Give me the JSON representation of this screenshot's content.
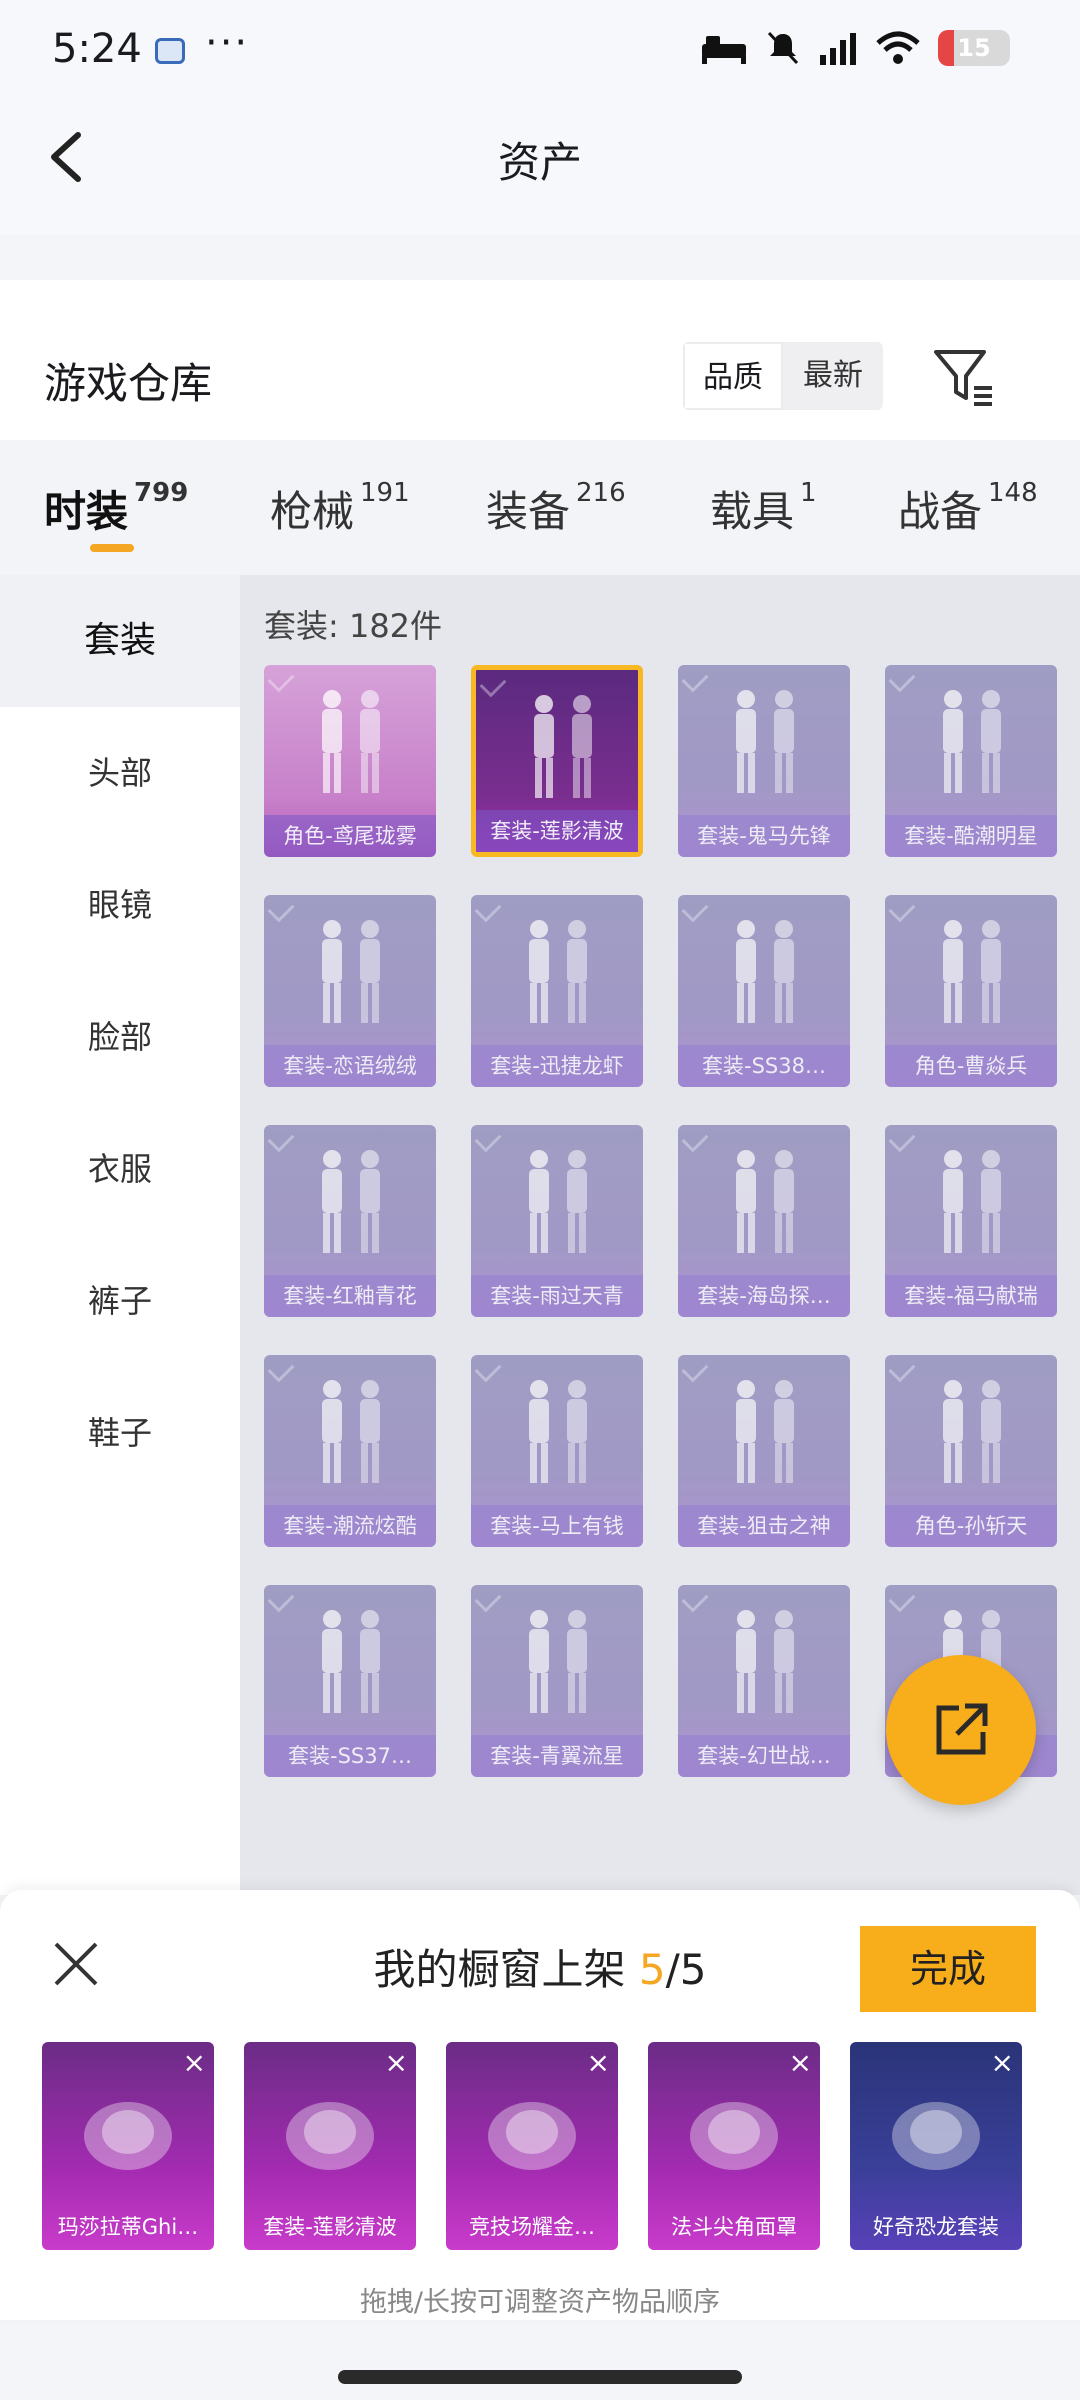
{
  "status": {
    "time": "5:24",
    "dots": "···",
    "battery": "15"
  },
  "header": {
    "title": "资产"
  },
  "warehouse": {
    "title": "游戏仓库",
    "sort_quality": "品质",
    "sort_latest": "最新"
  },
  "tabs": [
    {
      "label": "时装",
      "count": "799"
    },
    {
      "label": "枪械",
      "count": "191"
    },
    {
      "label": "装备",
      "count": "216"
    },
    {
      "label": "载具",
      "count": "1"
    },
    {
      "label": "战备",
      "count": "148"
    }
  ],
  "sidebar": [
    {
      "label": "套装"
    },
    {
      "label": "头部"
    },
    {
      "label": "眼镜"
    },
    {
      "label": "脸部"
    },
    {
      "label": "衣服"
    },
    {
      "label": "裤子"
    },
    {
      "label": "鞋子"
    }
  ],
  "count_text": "套装: 182件",
  "items": [
    {
      "label": "角色-鸢尾珑雾"
    },
    {
      "label": "套装-莲影清波"
    },
    {
      "label": "套装-鬼马先锋"
    },
    {
      "label": "套装-酷潮明星"
    },
    {
      "label": "套装-恋语绒绒"
    },
    {
      "label": "套装-迅捷龙虾"
    },
    {
      "label": "套装-SS38…"
    },
    {
      "label": "角色-曹焱兵"
    },
    {
      "label": "套装-红釉青花"
    },
    {
      "label": "套装-雨过天青"
    },
    {
      "label": "套装-海岛探…"
    },
    {
      "label": "套装-福马献瑞"
    },
    {
      "label": "套装-潮流炫酷"
    },
    {
      "label": "套装-马上有钱"
    },
    {
      "label": "套装-狙击之神"
    },
    {
      "label": "角色-孙斩天"
    },
    {
      "label": "套装-SS37…"
    },
    {
      "label": "套装-青翼流星"
    },
    {
      "label": "套装-幻世战…"
    },
    {
      "label": "角"
    }
  ],
  "panel": {
    "title": "我的橱窗上架",
    "count_current": "5",
    "count_sep": "/5",
    "done": "完成",
    "hint": "拖拽/长按可调整资产物品顺序",
    "close_mark": "×",
    "shelf": [
      {
        "label": "玛莎拉蒂Ghi…"
      },
      {
        "label": "套装-莲影清波"
      },
      {
        "label": "竞技场耀金…"
      },
      {
        "label": "法斗尖角面罩"
      },
      {
        "label": "好奇恐龙套装"
      }
    ]
  }
}
